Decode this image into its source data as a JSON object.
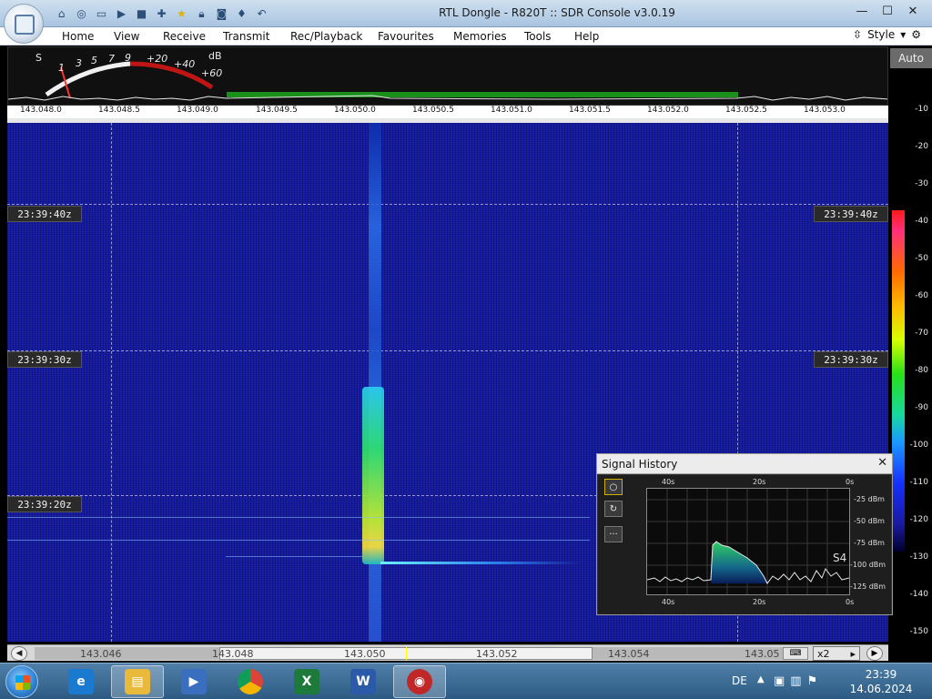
{
  "window": {
    "title": "RTL Dongle - R820T :: SDR Console v3.0.19",
    "controls": [
      "—",
      "☐",
      "✕"
    ]
  },
  "quick_access": [
    "home-icon",
    "lifebuoy-icon",
    "folder-icon",
    "play-icon",
    "stop-icon",
    "add-icon",
    "star-icon",
    "lock-icon",
    "camera-icon",
    "drop-icon",
    "undo-icon"
  ],
  "menu": {
    "items": [
      "Home",
      "View",
      "Receive",
      "Transmit",
      "Rec/Playback",
      "Favourites",
      "Memories",
      "Tools",
      "Help"
    ],
    "style_label": "Style"
  },
  "smeter": {
    "s_label": "S",
    "scale": [
      "1",
      "3",
      "5",
      "7",
      "9",
      "+20",
      "+40",
      "+60"
    ],
    "unit": "dB"
  },
  "frequency_scale": [
    "143.048.0",
    "143.048.5",
    "143.049.0",
    "143.049.5",
    "143.050.0",
    "143.050.5",
    "143.051.0",
    "143.051.5",
    "143.052.0",
    "143.052.5",
    "143.053.0"
  ],
  "waterfall": {
    "time_tags": [
      "23:39:40z",
      "23:39:30z",
      "23:39:20z"
    ]
  },
  "color_scale": {
    "auto_label": "Auto",
    "ticks": [
      "-10",
      "-20",
      "-30",
      "-40",
      "-50",
      "-60",
      "-70",
      "-80",
      "-90",
      "-100",
      "-110",
      "-120",
      "-130",
      "-140",
      "-150"
    ]
  },
  "signal_history": {
    "title": "Signal History",
    "close": "✕",
    "top_labels": [
      "40s",
      "20s",
      "0s"
    ],
    "bottom_labels": [
      "40s",
      "20s",
      "0s"
    ],
    "dbm_labels": [
      "-25 dBm",
      "-50 dBm",
      "-75 dBm",
      "-100 dBm",
      "-125 dBm"
    ],
    "s_reading": "S4",
    "tools": [
      "○",
      "↻",
      "···"
    ]
  },
  "bottom_scale": {
    "labels": [
      "143.046",
      "143.048",
      "143.050",
      "143.052",
      "143.054",
      "143.05"
    ],
    "zoom_label": "x2"
  },
  "taskbar": {
    "apps": [
      "internet-explorer-icon",
      "file-explorer-icon",
      "media-player-icon",
      "chrome-icon",
      "excel-icon",
      "word-icon",
      "sdr-console-icon"
    ],
    "language": "DE",
    "time": "23:39",
    "date": "14.06.2024"
  },
  "colors": {
    "waterfall_bg": "#141a9a",
    "accent": "#4f7fa8"
  }
}
